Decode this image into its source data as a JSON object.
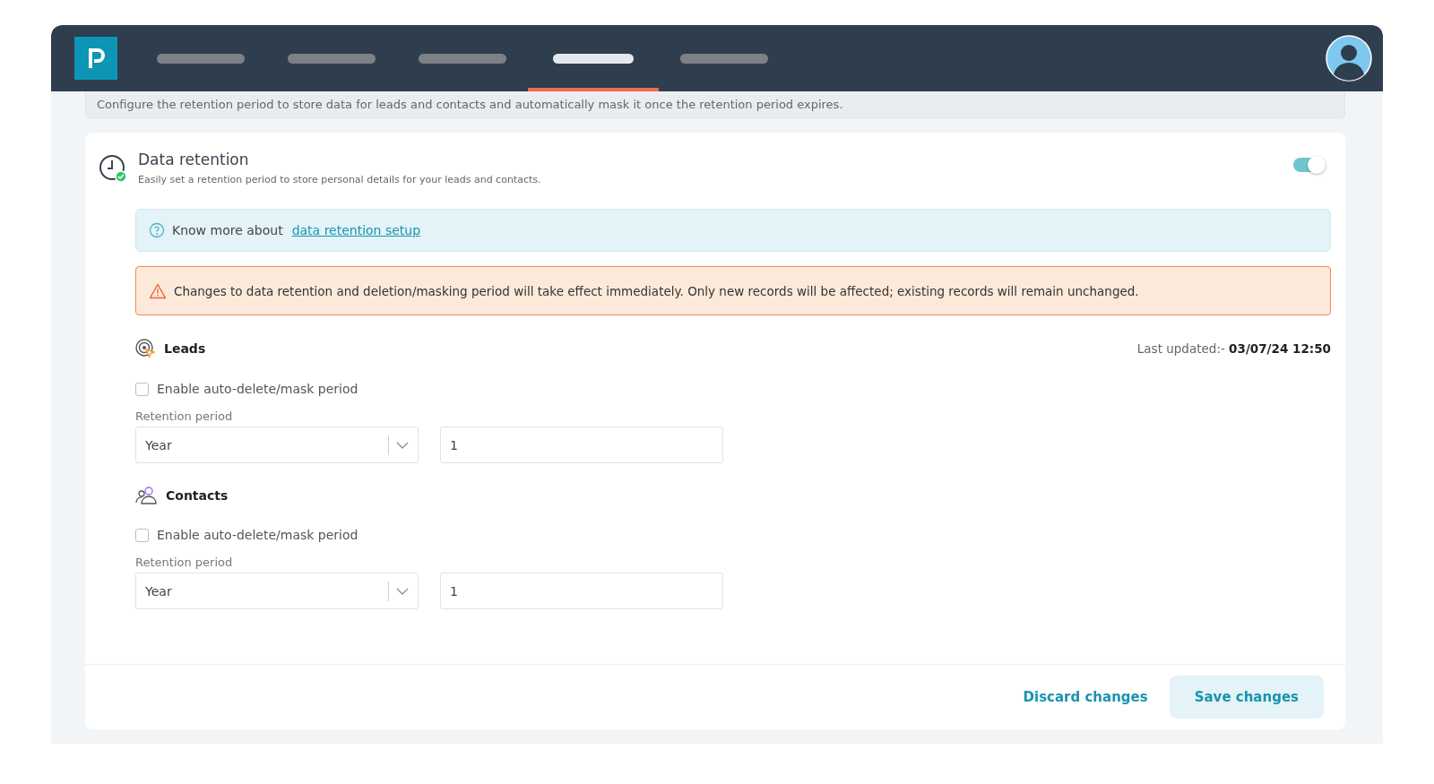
{
  "nav": {
    "tabs": [
      {
        "selected": false
      },
      {
        "selected": false
      },
      {
        "selected": false
      },
      {
        "selected": true
      },
      {
        "selected": false
      }
    ]
  },
  "description": "Configure the retention period to store data for leads and contacts and automatically mask it once the retention period expires.",
  "card": {
    "title": "Data retention",
    "subtitle": "Easily set a retention period to store personal details for your leads and contacts.",
    "enabled": {
      "on": true
    },
    "info": {
      "text": "Know more about",
      "link": "data retention setup"
    },
    "warning": "Changes to data retention and deletion/masking period will take effect immediately. Only new records will be affected; existing records will remain unchanged.",
    "sections": [
      {
        "kind": "leads",
        "title": "Leads",
        "last_updated": "Last updated:- **03/07/24 12:50**",
        "checkbox": {
          "label": "Enable auto-delete/mask period",
          "checked": false
        },
        "field_label": "Retention period",
        "unit": "Year",
        "value": "1"
      },
      {
        "kind": "contacts",
        "title": "Contacts",
        "checkbox": {
          "label": "Enable auto-delete/mask period",
          "checked": false
        },
        "field_label": "Retention period",
        "unit": "Year",
        "value": "1"
      }
    ],
    "buttons": {
      "discard": "Discard changes",
      "save": "Save changes"
    }
  }
}
